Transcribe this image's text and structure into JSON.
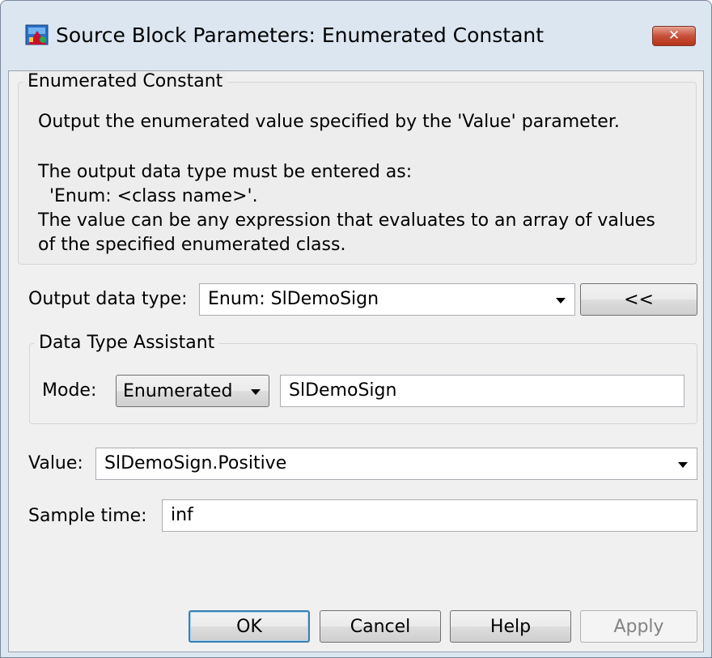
{
  "window": {
    "title": "Source Block Parameters: Enumerated Constant",
    "close_glyph": "✕"
  },
  "description": {
    "group_title": "Enumerated Constant",
    "line1": "Output the enumerated value specified by the 'Value' parameter.",
    "line2": "The output data type must be entered as:",
    "line3": "  'Enum: <class name>'.",
    "line4": "The value can be any expression that evaluates to an array of values",
    "line5": "of the specified enumerated class."
  },
  "output_data_type": {
    "label": "Output data type:",
    "value": "Enum: SlDemoSign",
    "assistant_toggle_label": "<<"
  },
  "data_type_assistant": {
    "group_title": "Data Type Assistant",
    "mode_label": "Mode:",
    "mode_value": "Enumerated",
    "class_name": "SlDemoSign"
  },
  "value": {
    "label": "Value:",
    "value": "SlDemoSign.Positive"
  },
  "sample_time": {
    "label": "Sample time:",
    "value": "inf"
  },
  "buttons": {
    "ok": "OK",
    "cancel": "Cancel",
    "help": "Help",
    "apply": "Apply"
  }
}
